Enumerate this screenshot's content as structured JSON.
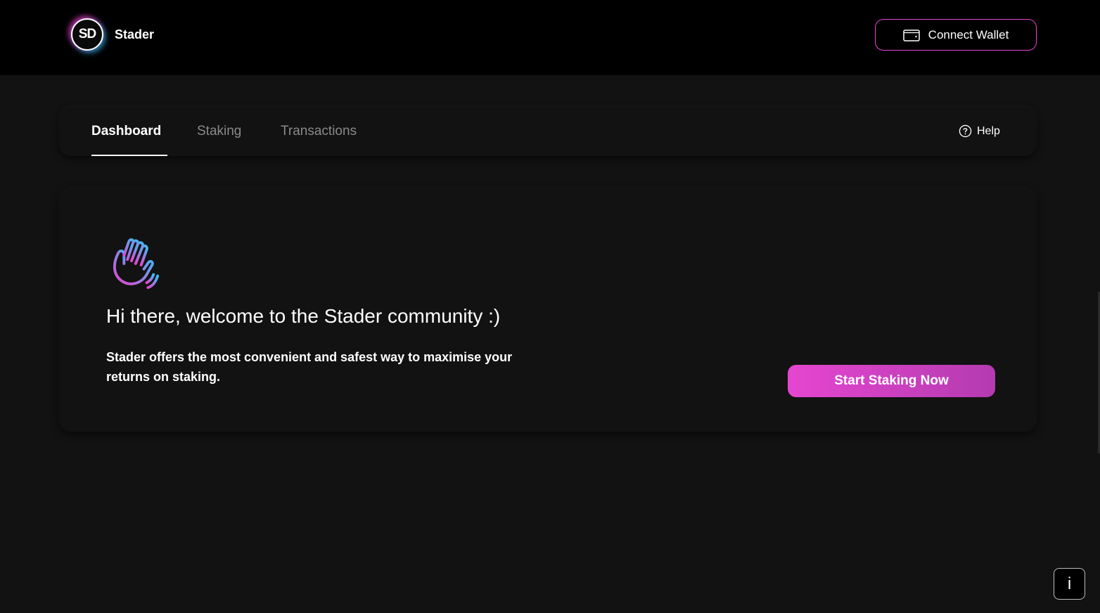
{
  "header": {
    "logo_text": "SD",
    "brand_name": "Stader",
    "connect_wallet_label": "Connect Wallet"
  },
  "nav": {
    "tabs": [
      {
        "label": "Dashboard",
        "active": true
      },
      {
        "label": "Staking",
        "active": false
      },
      {
        "label": "Transactions",
        "active": false
      }
    ],
    "help_label": "Help"
  },
  "welcome": {
    "title": "Hi there, welcome to the Stader community :)",
    "description": "Stader offers the most convenient and safest way to maximise your returns on staking.",
    "cta_label": "Start Staking Now"
  },
  "info_button_label": "i",
  "colors": {
    "accent": "#e546d0",
    "accent_secondary": "#38bdf8",
    "background": "#121212",
    "header_background": "#000000"
  }
}
